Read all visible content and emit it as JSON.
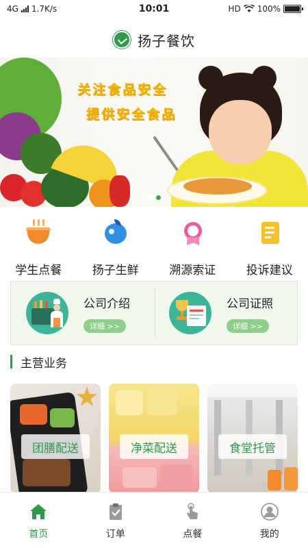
{
  "status_bar": {
    "network": "4G",
    "speed": "1.7K/s",
    "time": "10:01",
    "hd": "HD",
    "battery": "100%"
  },
  "header": {
    "title": "扬子餐饮",
    "logo_icon": "company-logo"
  },
  "banner": {
    "line1": "关注食品安全",
    "line2": "提供安全食品",
    "slide_count": 2,
    "active_slide": 2
  },
  "quick_menu": [
    {
      "label": "学生点餐",
      "icon": "noodle-bowl-icon"
    },
    {
      "label": "扬子生鲜",
      "icon": "eggplant-icon"
    },
    {
      "label": "溯源索证",
      "icon": "medal-icon"
    },
    {
      "label": "投诉建议",
      "icon": "note-icon"
    }
  ],
  "company": {
    "intro_title": "公司介绍",
    "intro_button": "详细 >>",
    "license_title": "公司证照",
    "license_button": "详细 >>"
  },
  "section": {
    "title": "主营业务"
  },
  "business": [
    {
      "label": "团膳配送"
    },
    {
      "label": "净菜配送"
    },
    {
      "label": "食堂托管"
    }
  ],
  "tabs": [
    {
      "label": "首页",
      "icon": "home-icon",
      "active": true
    },
    {
      "label": "订单",
      "icon": "clipboard-icon",
      "active": false
    },
    {
      "label": "点餐",
      "icon": "tap-hand-icon",
      "active": false
    },
    {
      "label": "我的",
      "icon": "user-icon",
      "active": false
    }
  ],
  "colors": {
    "brand_green": "#2e9a4a",
    "banner_text": "#f5b800",
    "card_bg": "#f0f8ee",
    "button_green": "#8fcf8c"
  }
}
